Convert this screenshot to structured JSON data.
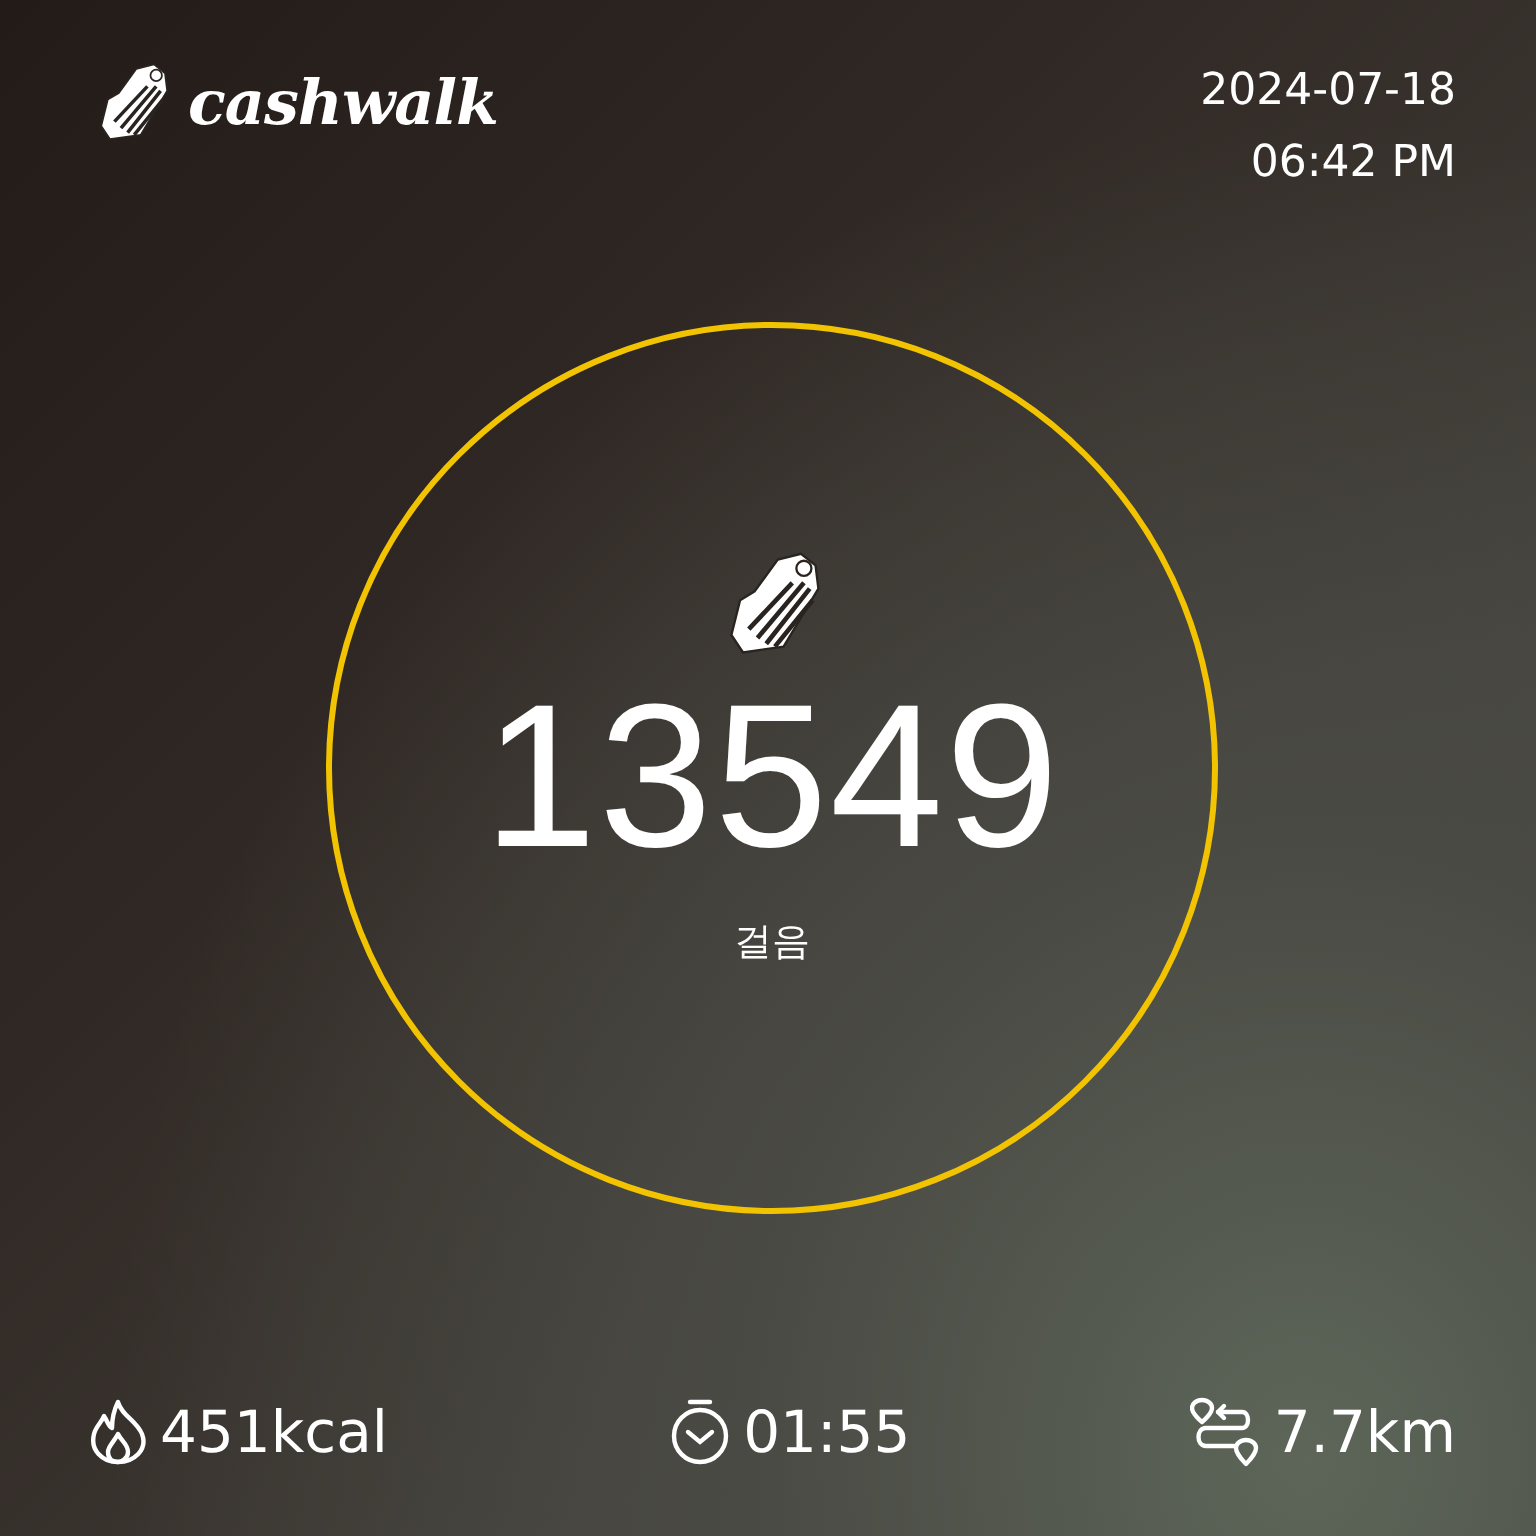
{
  "logo": {
    "text": "cashwalk"
  },
  "date": "2024-07-18",
  "time": "06:42 PM",
  "steps": {
    "value": "13549",
    "label": "걸음"
  },
  "stats": [
    {
      "kind": "calories",
      "text": "451kcal"
    },
    {
      "kind": "duration",
      "text": "01:55"
    },
    {
      "kind": "distance",
      "text": "7.7km"
    }
  ]
}
